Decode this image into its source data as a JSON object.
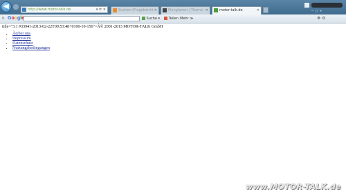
{
  "browser": {
    "address_url": "http://www.motor-talk.de",
    "tabs": [
      {
        "label": "Suchen (Fragebeiträge)"
      },
      {
        "label": "Pinnglamm / Themenanzeige"
      },
      {
        "label": "motor-talk.de",
        "active": true
      }
    ],
    "window_controls": "— ▢ ✕"
  },
  "toolbar": {
    "brand": "Google",
    "search_label": "Suche ▾",
    "share_label": "Teilen",
    "more_label": "Mehr ≫"
  },
  "page": {
    "raw_text": "title=\"3.1 #33941-2013-02-22T09:53:48+0100-10-156\">Â© 2001-2013 MOTOR-TALK GmbH",
    "links": [
      {
        "label": "Ãœber uns"
      },
      {
        "label": "Impressum"
      },
      {
        "label": "Datenschutz"
      },
      {
        "label": "Nutzungsbedingungen"
      }
    ]
  },
  "watermark": "www.MOTOR-TALK.de"
}
